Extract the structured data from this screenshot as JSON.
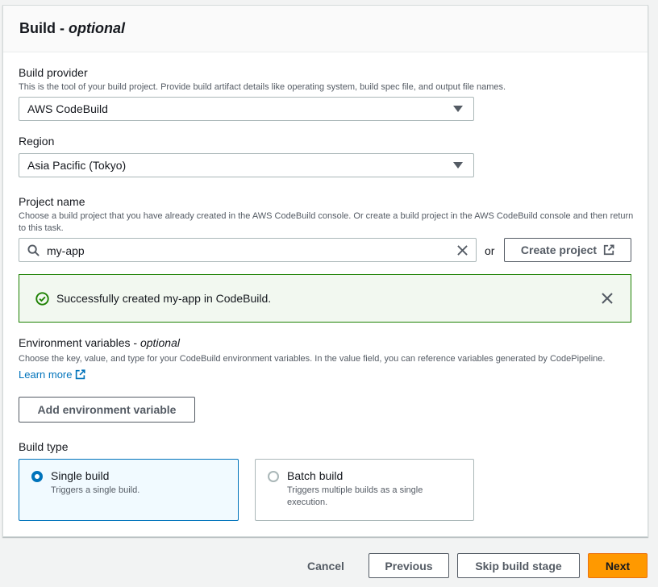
{
  "panel": {
    "title": "Build - ",
    "title_optional": "optional"
  },
  "build_provider": {
    "label": "Build provider",
    "description": "This is the tool of your build project. Provide build artifact details like operating system, build spec file, and output file names.",
    "value": "AWS CodeBuild"
  },
  "region": {
    "label": "Region",
    "value": "Asia Pacific (Tokyo)"
  },
  "project_name": {
    "label": "Project name",
    "description": "Choose a build project that you have already created in the AWS CodeBuild console. Or create a build project in the AWS CodeBuild console and then return to this task.",
    "value": "my-app",
    "or_text": "or",
    "create_label": "Create project"
  },
  "alert": {
    "message": "Successfully created my-app in CodeBuild.",
    "success_color": "#1d8102"
  },
  "env_vars": {
    "label": "Environment variables - ",
    "label_optional": "optional",
    "description": "Choose the key, value, and type for your CodeBuild environment variables. In the value field, you can reference variables generated by CodePipeline.",
    "learn_more": "Learn more",
    "add_label": "Add environment variable"
  },
  "build_type": {
    "label": "Build type",
    "options": [
      {
        "title": "Single build",
        "desc": "Triggers a single build.",
        "selected": true
      },
      {
        "title": "Batch build",
        "desc": "Triggers multiple builds as a single execution.",
        "selected": false
      }
    ]
  },
  "footer": {
    "cancel": "Cancel",
    "previous": "Previous",
    "skip": "Skip build stage",
    "next": "Next",
    "primary_color": "#ff9900"
  }
}
